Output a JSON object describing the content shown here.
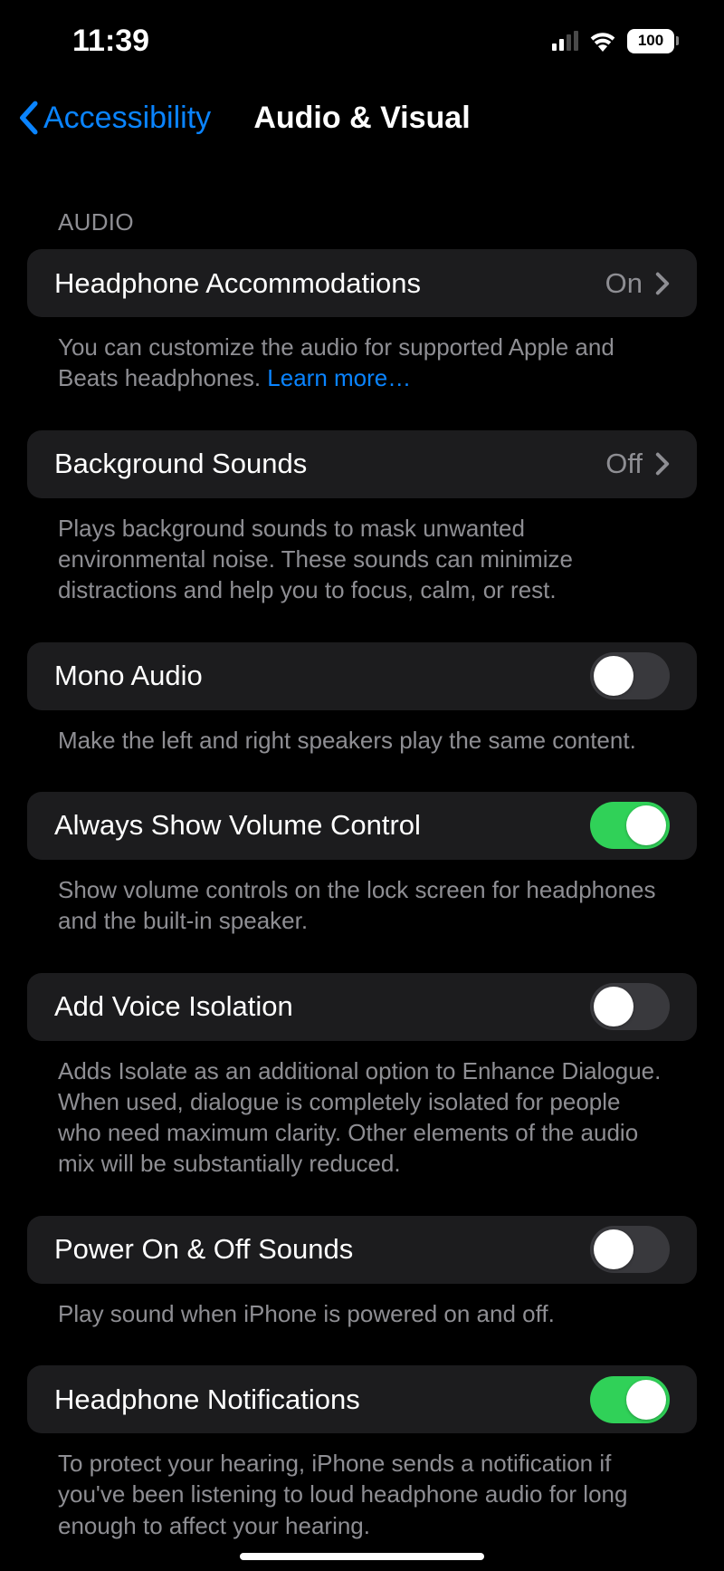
{
  "status": {
    "time": "11:39",
    "battery_label": "100"
  },
  "nav": {
    "back_label": "Accessibility",
    "title": "Audio & Visual"
  },
  "section_header": "AUDIO",
  "rows": {
    "headphone_accommodations": {
      "label": "Headphone Accommodations",
      "value": "On",
      "footer_prefix": "You can customize the audio for supported Apple and Beats headphones. ",
      "footer_link": "Learn more…"
    },
    "background_sounds": {
      "label": "Background Sounds",
      "value": "Off",
      "footer": "Plays background sounds to mask unwanted environmental noise. These sounds can minimize distractions and help you to focus, calm, or rest."
    },
    "mono_audio": {
      "label": "Mono Audio",
      "on": false,
      "footer": "Make the left and right speakers play the same content."
    },
    "volume_control": {
      "label": "Always Show Volume Control",
      "on": true,
      "footer": "Show volume controls on the lock screen for headphones and the built-in speaker."
    },
    "voice_isolation": {
      "label": "Add Voice Isolation",
      "on": false,
      "footer": "Adds Isolate as an additional option to Enhance Dialogue. When used, dialogue is completely isolated for people who need maximum clarity. Other elements of the audio mix will be substantially reduced."
    },
    "power_sounds": {
      "label": "Power On & Off Sounds",
      "on": false,
      "footer": "Play sound when iPhone is powered on and off."
    },
    "headphone_notifications": {
      "label": "Headphone Notifications",
      "on": true,
      "footer": "To protect your hearing, iPhone sends a notification if you've been listening to loud headphone audio for long enough to affect your hearing."
    }
  }
}
